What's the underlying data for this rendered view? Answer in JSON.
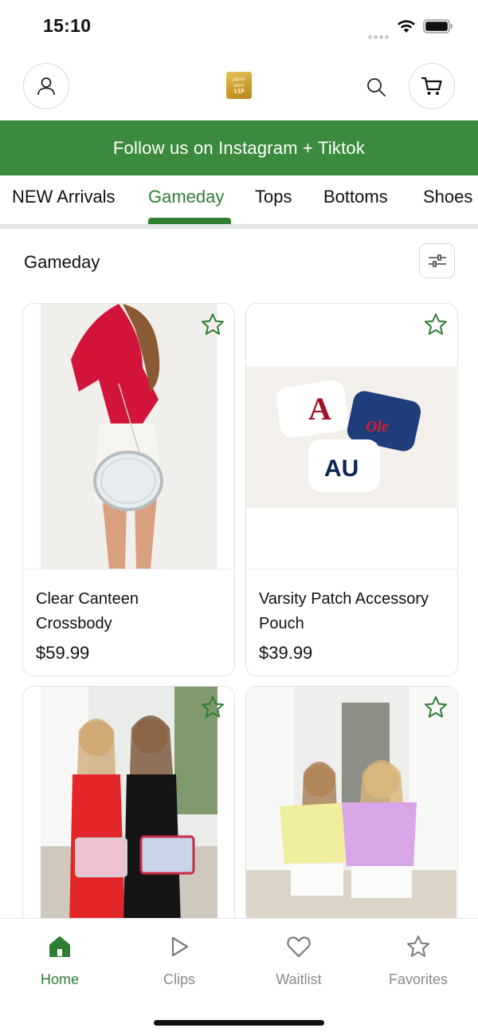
{
  "status_bar": {
    "time": "15:10"
  },
  "header": {
    "logo_text": [
      "pants",
      "store",
      "VIP"
    ]
  },
  "banner": {
    "text": "Follow us on Instagram + Tiktok"
  },
  "tabs": [
    {
      "label": "NEW Arrivals",
      "active": false
    },
    {
      "label": "Gameday",
      "active": true
    },
    {
      "label": "Tops",
      "active": false
    },
    {
      "label": "Bottoms",
      "active": false
    },
    {
      "label": "Shoes",
      "active": false
    }
  ],
  "section": {
    "title": "Gameday"
  },
  "products": [
    {
      "name": "Clear Canteen Crossbody",
      "price": "$59.99"
    },
    {
      "name": "Varsity Patch Accessory Pouch",
      "price": "$39.99"
    },
    {
      "name": "",
      "price": ""
    },
    {
      "name": "",
      "price": ""
    }
  ],
  "bottom_nav": [
    {
      "label": "Home",
      "icon": "home-icon",
      "active": true
    },
    {
      "label": "Clips",
      "icon": "play-icon",
      "active": false
    },
    {
      "label": "Waitlist",
      "icon": "heart-icon",
      "active": false
    },
    {
      "label": "Favorites",
      "icon": "star-icon",
      "active": false
    }
  ],
  "colors": {
    "brand_green": "#2f7d33",
    "banner_green": "#3b8a3e",
    "inactive_gray": "#8a8a8a"
  }
}
